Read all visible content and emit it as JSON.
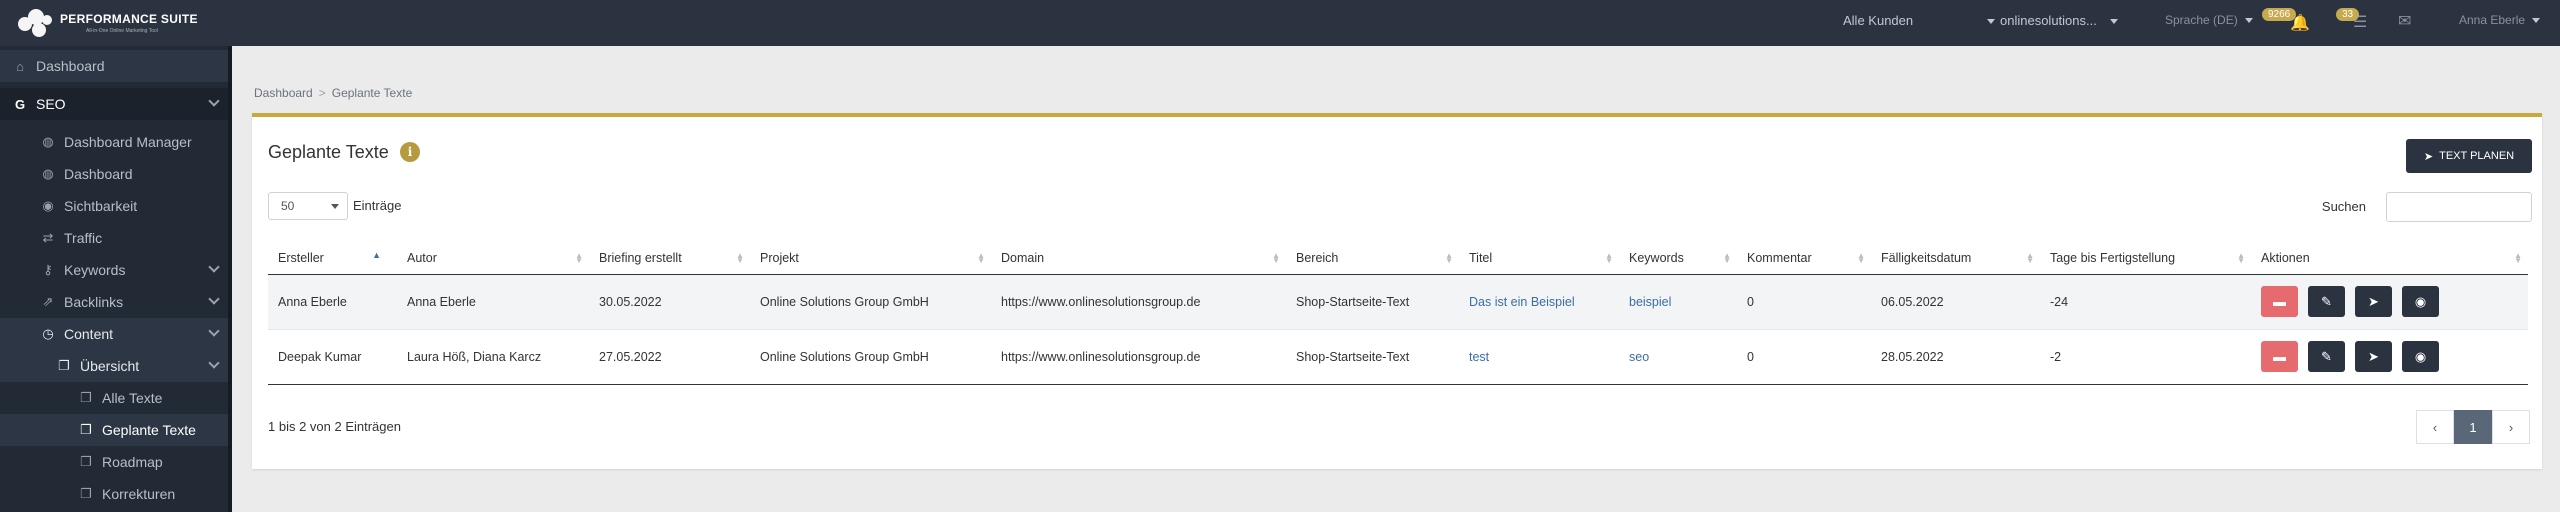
{
  "app": {
    "logo_title": "PERFORMANCE SUITE",
    "logo_subtitle": "All-in-One Online Marketing Tool"
  },
  "topbar": {
    "customer_select": "Alle Kunden",
    "project_select": "onlinesolutions...",
    "language_select": "Sprache (DE)",
    "notifications_count": "9266",
    "tasks_count": "33",
    "user_name": "Anna Eberle"
  },
  "sidebar": {
    "items": [
      {
        "label": "Dashboard",
        "icon": "home-icon"
      },
      {
        "label": "SEO",
        "icon": "google-icon"
      },
      {
        "label": "Dashboard Manager",
        "icon": "globe-icon"
      },
      {
        "label": "Dashboard",
        "icon": "globe-icon"
      },
      {
        "label": "Sichtbarkeit",
        "icon": "eye-icon"
      },
      {
        "label": "Traffic",
        "icon": "traffic-icon"
      },
      {
        "label": "Keywords",
        "icon": "key-icon"
      },
      {
        "label": "Backlinks",
        "icon": "external-link-icon"
      },
      {
        "label": "Content",
        "icon": "clock-icon"
      },
      {
        "label": "Übersicht",
        "icon": "copy-icon"
      },
      {
        "label": "Alle Texte",
        "icon": "copy-icon"
      },
      {
        "label": "Geplante Texte",
        "icon": "copy-icon"
      },
      {
        "label": "Roadmap",
        "icon": "copy-icon"
      },
      {
        "label": "Korrekturen",
        "icon": "copy-icon"
      }
    ]
  },
  "breadcrumb": {
    "root": "Dashboard",
    "separator": ">",
    "current": "Geplante Texte"
  },
  "panel": {
    "title": "Geplante Texte",
    "plan_button": "TEXT PLANEN",
    "page_length": "50",
    "page_length_label": "Einträge",
    "search_label": "Suchen",
    "search_value": "",
    "info": "1 bis 2 von 2 Einträgen",
    "current_page": "1"
  },
  "table": {
    "headers": [
      "Ersteller",
      "Autor",
      "Briefing erstellt",
      "Projekt",
      "Domain",
      "Bereich",
      "Titel",
      "Keywords",
      "Kommentar",
      "Fälligkeitsdatum",
      "Tage bis Fertigstellung",
      "Aktionen"
    ],
    "rows": [
      {
        "ersteller": "Anna Eberle",
        "autor": "Anna Eberle",
        "briefing": "30.05.2022",
        "projekt": "Online Solutions Group GmbH",
        "domain": "https://www.onlinesolutionsgroup.de",
        "bereich": "Shop-Startseite-Text",
        "titel": "Das ist ein Beispiel",
        "keywords": "beispiel",
        "kommentar": "0",
        "faellig": "06.05.2022",
        "tage": "-24"
      },
      {
        "ersteller": "Deepak Kumar",
        "autor": "Laura Höß, Diana Karcz",
        "briefing": "27.05.2022",
        "projekt": "Online Solutions Group GmbH",
        "domain": "https://www.onlinesolutionsgroup.de",
        "bereich": "Shop-Startseite-Text",
        "titel": "test",
        "keywords": "seo",
        "kommentar": "0",
        "faellig": "28.05.2022",
        "tage": "-2"
      }
    ]
  },
  "colors": {
    "topbar": "#2b3340",
    "sidebar": "#222a35",
    "accent": "#c9a93c",
    "delete": "#e56b6f",
    "link": "#3a6ea5"
  }
}
